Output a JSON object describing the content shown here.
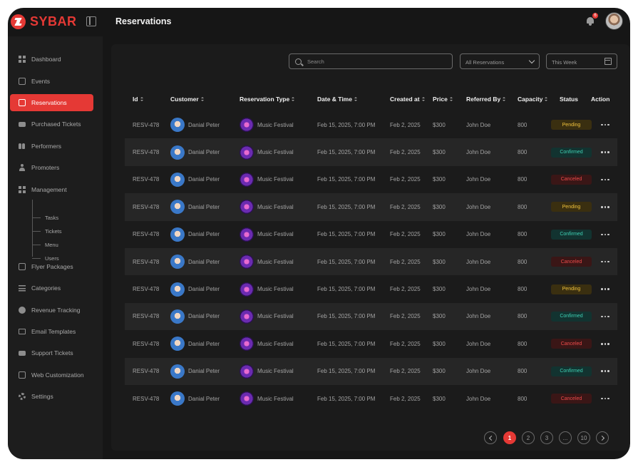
{
  "app": {
    "logo_text": "SYBAR",
    "brand_color": "#e53935"
  },
  "header": {
    "title": "Reservations",
    "notification_count": "6"
  },
  "sidebar": {
    "items": [
      {
        "label": "Dashboard",
        "icon": "dashboard-icon"
      },
      {
        "label": "Events",
        "icon": "calendar-icon"
      },
      {
        "label": "Reservations",
        "icon": "reservations-icon",
        "active": true
      },
      {
        "label": "Purchased Tickets",
        "icon": "ticket-icon"
      },
      {
        "label": "Performers",
        "icon": "performers-icon"
      },
      {
        "label": "Promoters",
        "icon": "promoter-icon"
      },
      {
        "label": "Management",
        "icon": "management-icon"
      },
      {
        "label": "Flyer Packages",
        "icon": "flyer-icon"
      },
      {
        "label": "Categories",
        "icon": "categories-icon"
      },
      {
        "label": "Revenue Tracking",
        "icon": "revenue-icon"
      },
      {
        "label": "Email Templates",
        "icon": "email-icon"
      },
      {
        "label": "Support Tickets",
        "icon": "support-icon"
      },
      {
        "label": "Web Customization",
        "icon": "web-icon"
      },
      {
        "label": "Settings",
        "icon": "settings-icon"
      }
    ],
    "management_sub": [
      "Tasks",
      "Tickets",
      "Menu",
      "Users"
    ]
  },
  "filters": {
    "search_placeholder": "Search",
    "reservation_filter": "All Reservations",
    "date_range": "This Week"
  },
  "table": {
    "columns": [
      "Id",
      "Customer",
      "Reservation Type",
      "Date & Time",
      "Created at",
      "Price",
      "Referred By",
      "Capacity",
      "Status",
      "Action"
    ],
    "rows": [
      {
        "id": "RESV-478",
        "customer": "Danial Peter",
        "type": "Music Festival",
        "datetime": "Feb 15, 2025, 7:00 PM",
        "created": "Feb 2, 2025",
        "price": "$300",
        "referred": "John Doe",
        "capacity": "800",
        "status": "Pending"
      },
      {
        "id": "RESV-478",
        "customer": "Danial Peter",
        "type": "Music Festival",
        "datetime": "Feb 15, 2025, 7:00 PM",
        "created": "Feb 2, 2025",
        "price": "$300",
        "referred": "John Doe",
        "capacity": "800",
        "status": "Confirmed"
      },
      {
        "id": "RESV-478",
        "customer": "Danial Peter",
        "type": "Music Festival",
        "datetime": "Feb 15, 2025, 7:00 PM",
        "created": "Feb 2, 2025",
        "price": "$300",
        "referred": "John Doe",
        "capacity": "800",
        "status": "Canceled"
      },
      {
        "id": "RESV-478",
        "customer": "Danial Peter",
        "type": "Music Festival",
        "datetime": "Feb 15, 2025, 7:00 PM",
        "created": "Feb 2, 2025",
        "price": "$300",
        "referred": "John Doe",
        "capacity": "800",
        "status": "Pending"
      },
      {
        "id": "RESV-478",
        "customer": "Danial Peter",
        "type": "Music Festival",
        "datetime": "Feb 15, 2025, 7:00 PM",
        "created": "Feb 2, 2025",
        "price": "$300",
        "referred": "John Doe",
        "capacity": "800",
        "status": "Confirmed"
      },
      {
        "id": "RESV-478",
        "customer": "Danial Peter",
        "type": "Music Festival",
        "datetime": "Feb 15, 2025, 7:00 PM",
        "created": "Feb 2, 2025",
        "price": "$300",
        "referred": "John Doe",
        "capacity": "800",
        "status": "Canceled"
      },
      {
        "id": "RESV-478",
        "customer": "Danial Peter",
        "type": "Music Festival",
        "datetime": "Feb 15, 2025, 7:00 PM",
        "created": "Feb 2, 2025",
        "price": "$300",
        "referred": "John Doe",
        "capacity": "800",
        "status": "Pending"
      },
      {
        "id": "RESV-478",
        "customer": "Danial Peter",
        "type": "Music Festival",
        "datetime": "Feb 15, 2025, 7:00 PM",
        "created": "Feb 2, 2025",
        "price": "$300",
        "referred": "John Doe",
        "capacity": "800",
        "status": "Confirmed"
      },
      {
        "id": "RESV-478",
        "customer": "Danial Peter",
        "type": "Music Festival",
        "datetime": "Feb 15, 2025, 7:00 PM",
        "created": "Feb 2, 2025",
        "price": "$300",
        "referred": "John Doe",
        "capacity": "800",
        "status": "Canceled"
      },
      {
        "id": "RESV-478",
        "customer": "Danial Peter",
        "type": "Music Festival",
        "datetime": "Feb 15, 2025, 7:00 PM",
        "created": "Feb 2, 2025",
        "price": "$300",
        "referred": "John Doe",
        "capacity": "800",
        "status": "Confirmed"
      },
      {
        "id": "RESV-478",
        "customer": "Danial Peter",
        "type": "Music Festival",
        "datetime": "Feb 15, 2025, 7:00 PM",
        "created": "Feb 2, 2025",
        "price": "$300",
        "referred": "John Doe",
        "capacity": "800",
        "status": "Canceled"
      }
    ]
  },
  "pagination": {
    "pages": [
      "1",
      "2",
      "3",
      "...",
      "10"
    ],
    "current": "1"
  }
}
